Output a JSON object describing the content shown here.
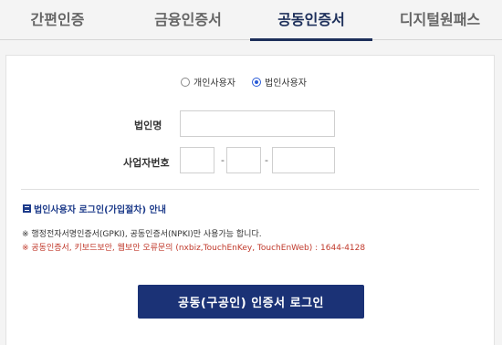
{
  "tabs": [
    {
      "label": "간편인증"
    },
    {
      "label": "금융인증서"
    },
    {
      "label": "공동인증서",
      "active": true
    },
    {
      "label": "디지털원패스"
    }
  ],
  "user_type": {
    "options": [
      "개인사용자",
      "법인사용자"
    ],
    "selected": "법인사용자"
  },
  "form": {
    "corp_name_label": "법인명",
    "corp_name_value": "",
    "biz_no_label": "사업자번호",
    "biz_no_part1": "",
    "biz_no_part2": "",
    "biz_no_part3": "",
    "separator": "-"
  },
  "guide_link": "법인사용자 로그인(가입절차) 안내",
  "notes": {
    "line1": "※ 행정전자서명인증서(GPKI), 공동인증서(NPKI)만 사용가능 합니다.",
    "line2": "※ 공동인증서, 키보드보안, 웹보안 오류문의 (nxbiz,TouchEnKey, TouchEnWeb) : 1644-4128"
  },
  "login_button": "공동(구공인) 인증서 로그인",
  "colors": {
    "accent": "#1d2f5a",
    "button": "#1b3276",
    "warning": "#c0392b"
  }
}
